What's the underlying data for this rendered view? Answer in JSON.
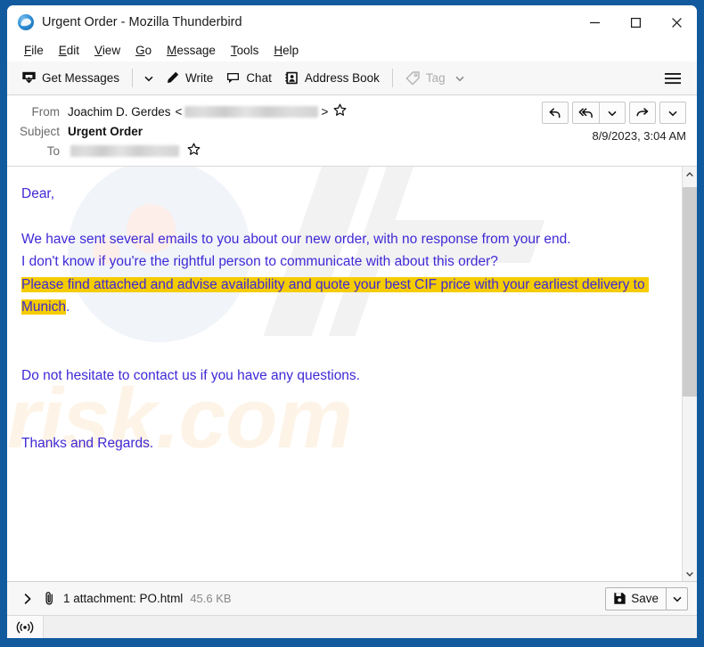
{
  "window": {
    "title": "Urgent Order - Mozilla Thunderbird",
    "logo_icon": "thunderbird-logo-icon",
    "controls": {
      "minimize": "minimize-icon",
      "maximize": "maximize-icon",
      "close": "close-icon"
    },
    "frame_color": "#125a9e"
  },
  "menubar": {
    "items": [
      {
        "label": "File",
        "accel": "F",
        "rest": "ile"
      },
      {
        "label": "Edit",
        "accel": "E",
        "rest": "dit"
      },
      {
        "label": "View",
        "accel": "V",
        "rest": "iew"
      },
      {
        "label": "Go",
        "accel": "G",
        "rest": "o"
      },
      {
        "label": "Message",
        "accel": "M",
        "rest": "essage"
      },
      {
        "label": "Tools",
        "accel": "T",
        "rest": "ools"
      },
      {
        "label": "Help",
        "accel": "H",
        "rest": "elp"
      }
    ]
  },
  "toolbar": {
    "get_messages_label": "Get Messages",
    "get_messages_icon": "inbox-download-icon",
    "get_messages_dropdown_icon": "chevron-down-icon",
    "write_label": "Write",
    "write_icon": "pencil-icon",
    "chat_label": "Chat",
    "chat_icon": "speech-bubble-icon",
    "address_book_label": "Address Book",
    "address_book_icon": "address-book-icon",
    "tag_label": "Tag",
    "tag_icon": "tag-icon",
    "tag_dropdown_icon": "chevron-down-icon",
    "tag_disabled": true,
    "hamburger_icon": "hamburger-menu-icon"
  },
  "message_header": {
    "from_label": "From",
    "from_name": "Joachim D. Gerdes",
    "from_angle_open": "<",
    "from_angle_close": ">",
    "from_address_redacted": true,
    "from_star_icon": "star-icon",
    "subject_label": "Subject",
    "subject_value": "Urgent Order",
    "to_label": "To",
    "to_address_redacted": true,
    "to_star_icon": "star-icon",
    "date": "8/9/2023, 3:04 AM",
    "actions": [
      {
        "name": "reply-button",
        "icon": "reply-arrow-icon"
      },
      {
        "name": "reply-all-button",
        "icon": "reply-all-arrow-icon"
      },
      {
        "name": "reply-all-dropdown-button",
        "icon": "chevron-down-icon"
      },
      {
        "name": "forward-button",
        "icon": "forward-arrow-icon"
      },
      {
        "name": "more-actions-dropdown-button",
        "icon": "chevron-down-icon"
      }
    ]
  },
  "body": {
    "text_color": "#3f29d6",
    "highlight_color": "#f5cc00",
    "watermark_text": "risk.com",
    "lines": [
      {
        "type": "text",
        "text": "Dear,"
      },
      {
        "type": "spacer"
      },
      {
        "type": "text",
        "text": "We have sent several emails to you about our new order, with no response from your end."
      },
      {
        "type": "text",
        "text": "I don't know if you're the rightful person to communicate with about this order?"
      },
      {
        "type": "highlight",
        "text": "Please find attached and advise availability and quote your best CIF price with your earliest delivery to Munich",
        "tail": "."
      },
      {
        "type": "spacer2"
      },
      {
        "type": "text",
        "text": "Do not hesitate to contact us if you have any questions."
      },
      {
        "type": "spacer2"
      },
      {
        "type": "text",
        "text": "Thanks and Regards."
      }
    ]
  },
  "scrollbar": {
    "up_icon": "chevron-up-icon",
    "down_icon": "chevron-down-icon"
  },
  "attachment_bar": {
    "expand_icon": "chevron-right-icon",
    "clip_icon": "paperclip-icon",
    "text": "1 attachment: PO.html",
    "size": "45.6 KB",
    "save_label": "Save",
    "save_icon": "floppy-disk-icon",
    "save_dropdown_icon": "chevron-down-icon"
  },
  "statusbar": {
    "icon": "broadcast-signal-icon",
    "text": ""
  }
}
